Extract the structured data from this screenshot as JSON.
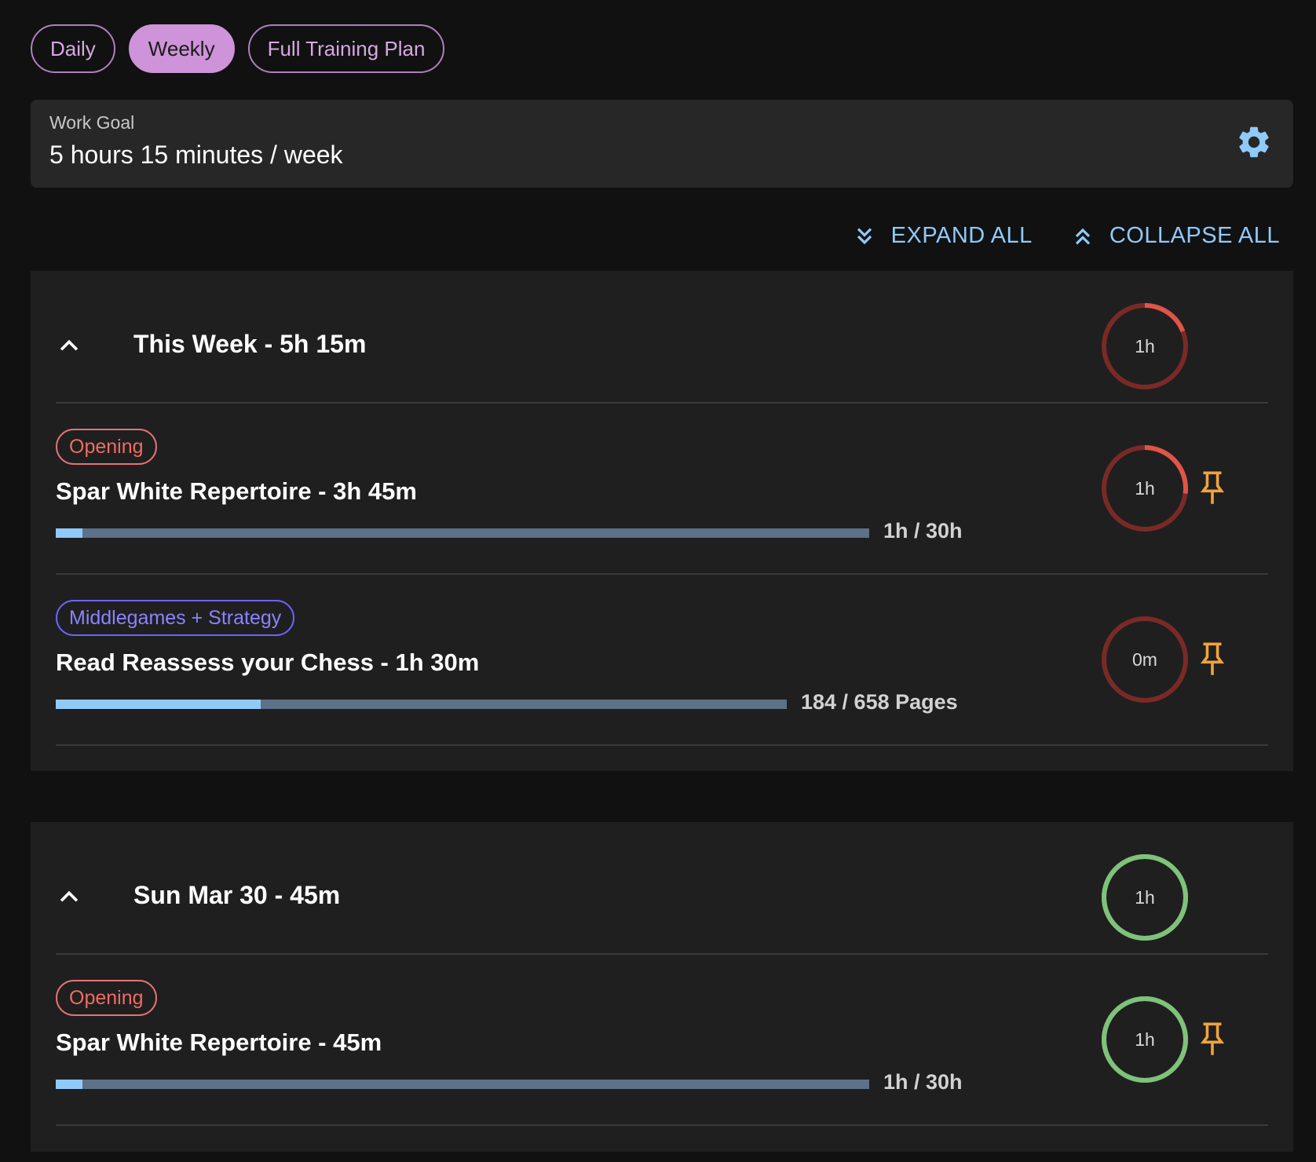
{
  "tabs": [
    {
      "label": "Daily",
      "active": false
    },
    {
      "label": "Weekly",
      "active": true
    },
    {
      "label": "Full Training Plan",
      "active": false
    }
  ],
  "work_goal": {
    "label": "Work Goal",
    "value": "5 hours 15 minutes / week",
    "settings_icon": "gear-icon"
  },
  "actions": {
    "expand_all": "EXPAND ALL",
    "collapse_all": "COLLAPSE ALL"
  },
  "colors": {
    "accent": "#ce93d8",
    "link": "#90caf9",
    "ring_behind": "#e05548",
    "ring_behind_track": "#7a2a26",
    "ring_done": "#7fc27a",
    "pin": "#f0a33a",
    "opening": "#e57373",
    "middlegames": "#6c63ff"
  },
  "sections": [
    {
      "title": "This Week - 5h 15m",
      "ring_label": "1h",
      "ring_progress": 0.19,
      "ring_status": "behind",
      "items": [
        {
          "tag": "Opening",
          "tag_kind": "opening",
          "title": "Spar White Repertoire - 3h 45m",
          "progress_label": "1h / 30h",
          "progress": 0.033,
          "ring_label": "1h",
          "ring_progress": 0.27,
          "ring_status": "behind",
          "pin_icon": "pin-icon"
        },
        {
          "tag": "Middlegames + Strategy",
          "tag_kind": "middle",
          "title": "Read Reassess your Chess - 1h 30m",
          "progress_label": "184 / 658 Pages",
          "progress": 0.28,
          "ring_label": "0m",
          "ring_progress": 0,
          "ring_status": "behind",
          "pin_icon": "pin-icon"
        }
      ]
    },
    {
      "title": "Sun Mar 30 - 45m",
      "ring_label": "1h",
      "ring_progress": 1,
      "ring_status": "done",
      "items": [
        {
          "tag": "Opening",
          "tag_kind": "opening",
          "title": "Spar White Repertoire - 45m",
          "progress_label": "1h / 30h",
          "progress": 0.033,
          "ring_label": "1h",
          "ring_progress": 1,
          "ring_status": "done",
          "pin_icon": "pin-icon"
        }
      ]
    }
  ]
}
